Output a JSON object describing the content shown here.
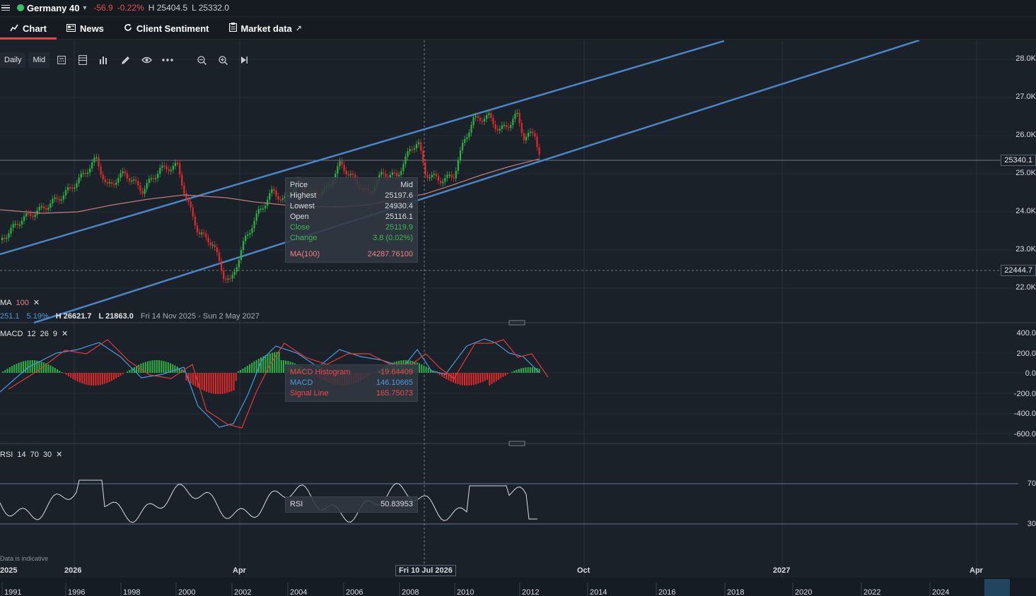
{
  "instrument": {
    "name": "Germany 40",
    "change": "-56.9",
    "change_pct": "-0.22%",
    "high": "H 25404.5",
    "low": "L 25332.0"
  },
  "tabs": [
    {
      "label": "Chart",
      "icon": "chart-icon"
    },
    {
      "label": "News",
      "icon": "news-icon"
    },
    {
      "label": "Client Sentiment",
      "icon": "refresh-icon"
    },
    {
      "label": "Market data",
      "icon": "market-data-icon"
    }
  ],
  "toolbar": {
    "interval": "Daily",
    "price_type": "Mid"
  },
  "price_axis": {
    "ticks": [
      "28.0K",
      "27.0K",
      "26.0K",
      "25.0K",
      "24.0K",
      "23.0K",
      "22.0K"
    ],
    "current_price": "25340.1",
    "crosshair_price": "22444.7"
  },
  "ma_info": {
    "label": "MA",
    "period": "100",
    "value": "251.1",
    "pct": "5.19%",
    "high": "H 26621.7",
    "low": "L 21863.0",
    "range": "Fri 14 Nov 2025 - Sun 2 May 2027"
  },
  "price_tooltip": {
    "header_label": "Price",
    "header_value": "Mid",
    "highest_label": "Highest",
    "highest": "25197.6",
    "lowest_label": "Lowest",
    "lowest": "24930.4",
    "open_label": "Open",
    "open": "25116.1",
    "close_label": "Close",
    "close": "25119.9",
    "change_label": "Change",
    "change": "3.8 (0.02%)",
    "ma_label": "MA(100)",
    "ma": "24287.76100"
  },
  "macd": {
    "label": "MACD",
    "params": [
      "12",
      "26",
      "9"
    ],
    "axis": [
      "400.0",
      "200.0",
      "0.0",
      "-200.0",
      "-400.0",
      "-600.0"
    ],
    "tooltip": {
      "hist_label": "MACD Histogram",
      "hist": "-19.64409",
      "macd_label": "MACD",
      "macd": "146.10665",
      "signal_label": "Signal Line",
      "signal": "165.75073"
    }
  },
  "rsi": {
    "label": "RSI",
    "params": [
      "14",
      "70",
      "30"
    ],
    "axis": [
      "70",
      "30"
    ],
    "tooltip_label": "RSI",
    "tooltip_value": "50.83953"
  },
  "x_axis": {
    "labels": [
      "2025",
      "2026",
      "Apr",
      "Oct",
      "2027",
      "Apr"
    ],
    "crosshair_date": "Fri 10 Jul 2026",
    "note": "Data is indicative"
  },
  "navigator": {
    "years": [
      "1991",
      "1996",
      "1998",
      "2000",
      "2002",
      "2004",
      "2006",
      "2008",
      "2010",
      "2012",
      "2014",
      "2016",
      "2018",
      "2020",
      "2022",
      "2024"
    ]
  },
  "colors": {
    "background": "#1b2129",
    "up": "#2fb344",
    "down": "#e02b2b",
    "channel": "#4a86c5",
    "ma": "#c07a7a",
    "accent": "#e54848"
  }
}
